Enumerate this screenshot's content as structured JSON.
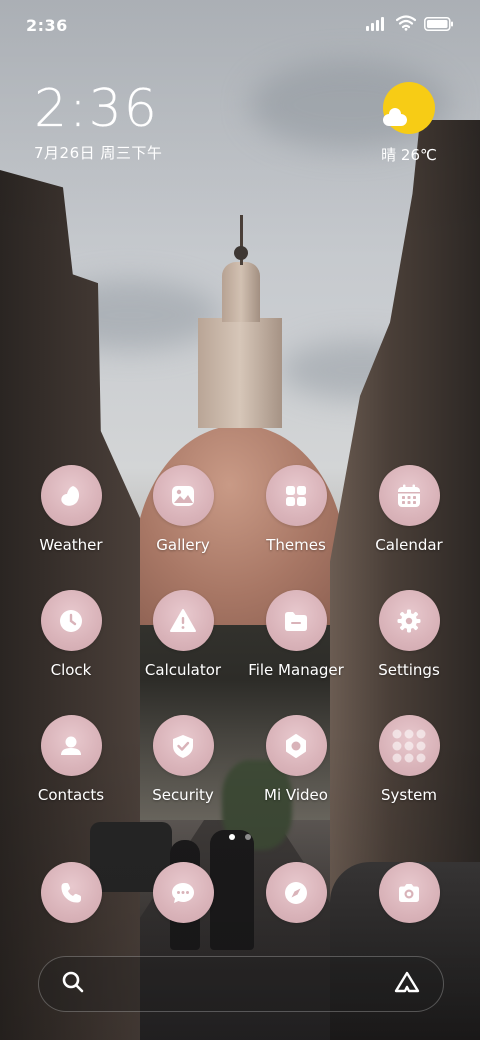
{
  "status_bar": {
    "time": "2:36",
    "icons": [
      "signal-icon",
      "wifi-icon",
      "battery-icon"
    ]
  },
  "clock_widget": {
    "time": "2:36",
    "date": "7月26日 周三下午"
  },
  "weather_widget": {
    "icon": "sunny-partly-cloudy-icon",
    "text": "晴 26℃"
  },
  "apps": [
    {
      "label": "Weather",
      "icon": "weather-icon"
    },
    {
      "label": "Gallery",
      "icon": "gallery-icon"
    },
    {
      "label": "Themes",
      "icon": "themes-icon"
    },
    {
      "label": "Calendar",
      "icon": "calendar-icon"
    },
    {
      "label": "Clock",
      "icon": "clock-icon"
    },
    {
      "label": "Calculator",
      "icon": "calculator-icon"
    },
    {
      "label": "File Manager",
      "icon": "file-manager-icon"
    },
    {
      "label": "Settings",
      "icon": "settings-icon"
    },
    {
      "label": "Contacts",
      "icon": "contacts-icon"
    },
    {
      "label": "Security",
      "icon": "security-icon"
    },
    {
      "label": "Mi Video",
      "icon": "video-icon"
    },
    {
      "label": "System",
      "icon": "system-folder-icon"
    }
  ],
  "dock": [
    {
      "icon": "phone-icon"
    },
    {
      "icon": "messages-icon"
    },
    {
      "icon": "browser-icon"
    },
    {
      "icon": "camera-icon"
    }
  ],
  "page_indicator": {
    "count": 2,
    "active": 1
  },
  "search_bar": {
    "left_icon": "search-icon",
    "right_icon": "assistant-icon"
  },
  "colors": {
    "icon_bg": "#d9b3b9",
    "icon_glyph": "#ffffff",
    "sun": "#f7cc15"
  }
}
